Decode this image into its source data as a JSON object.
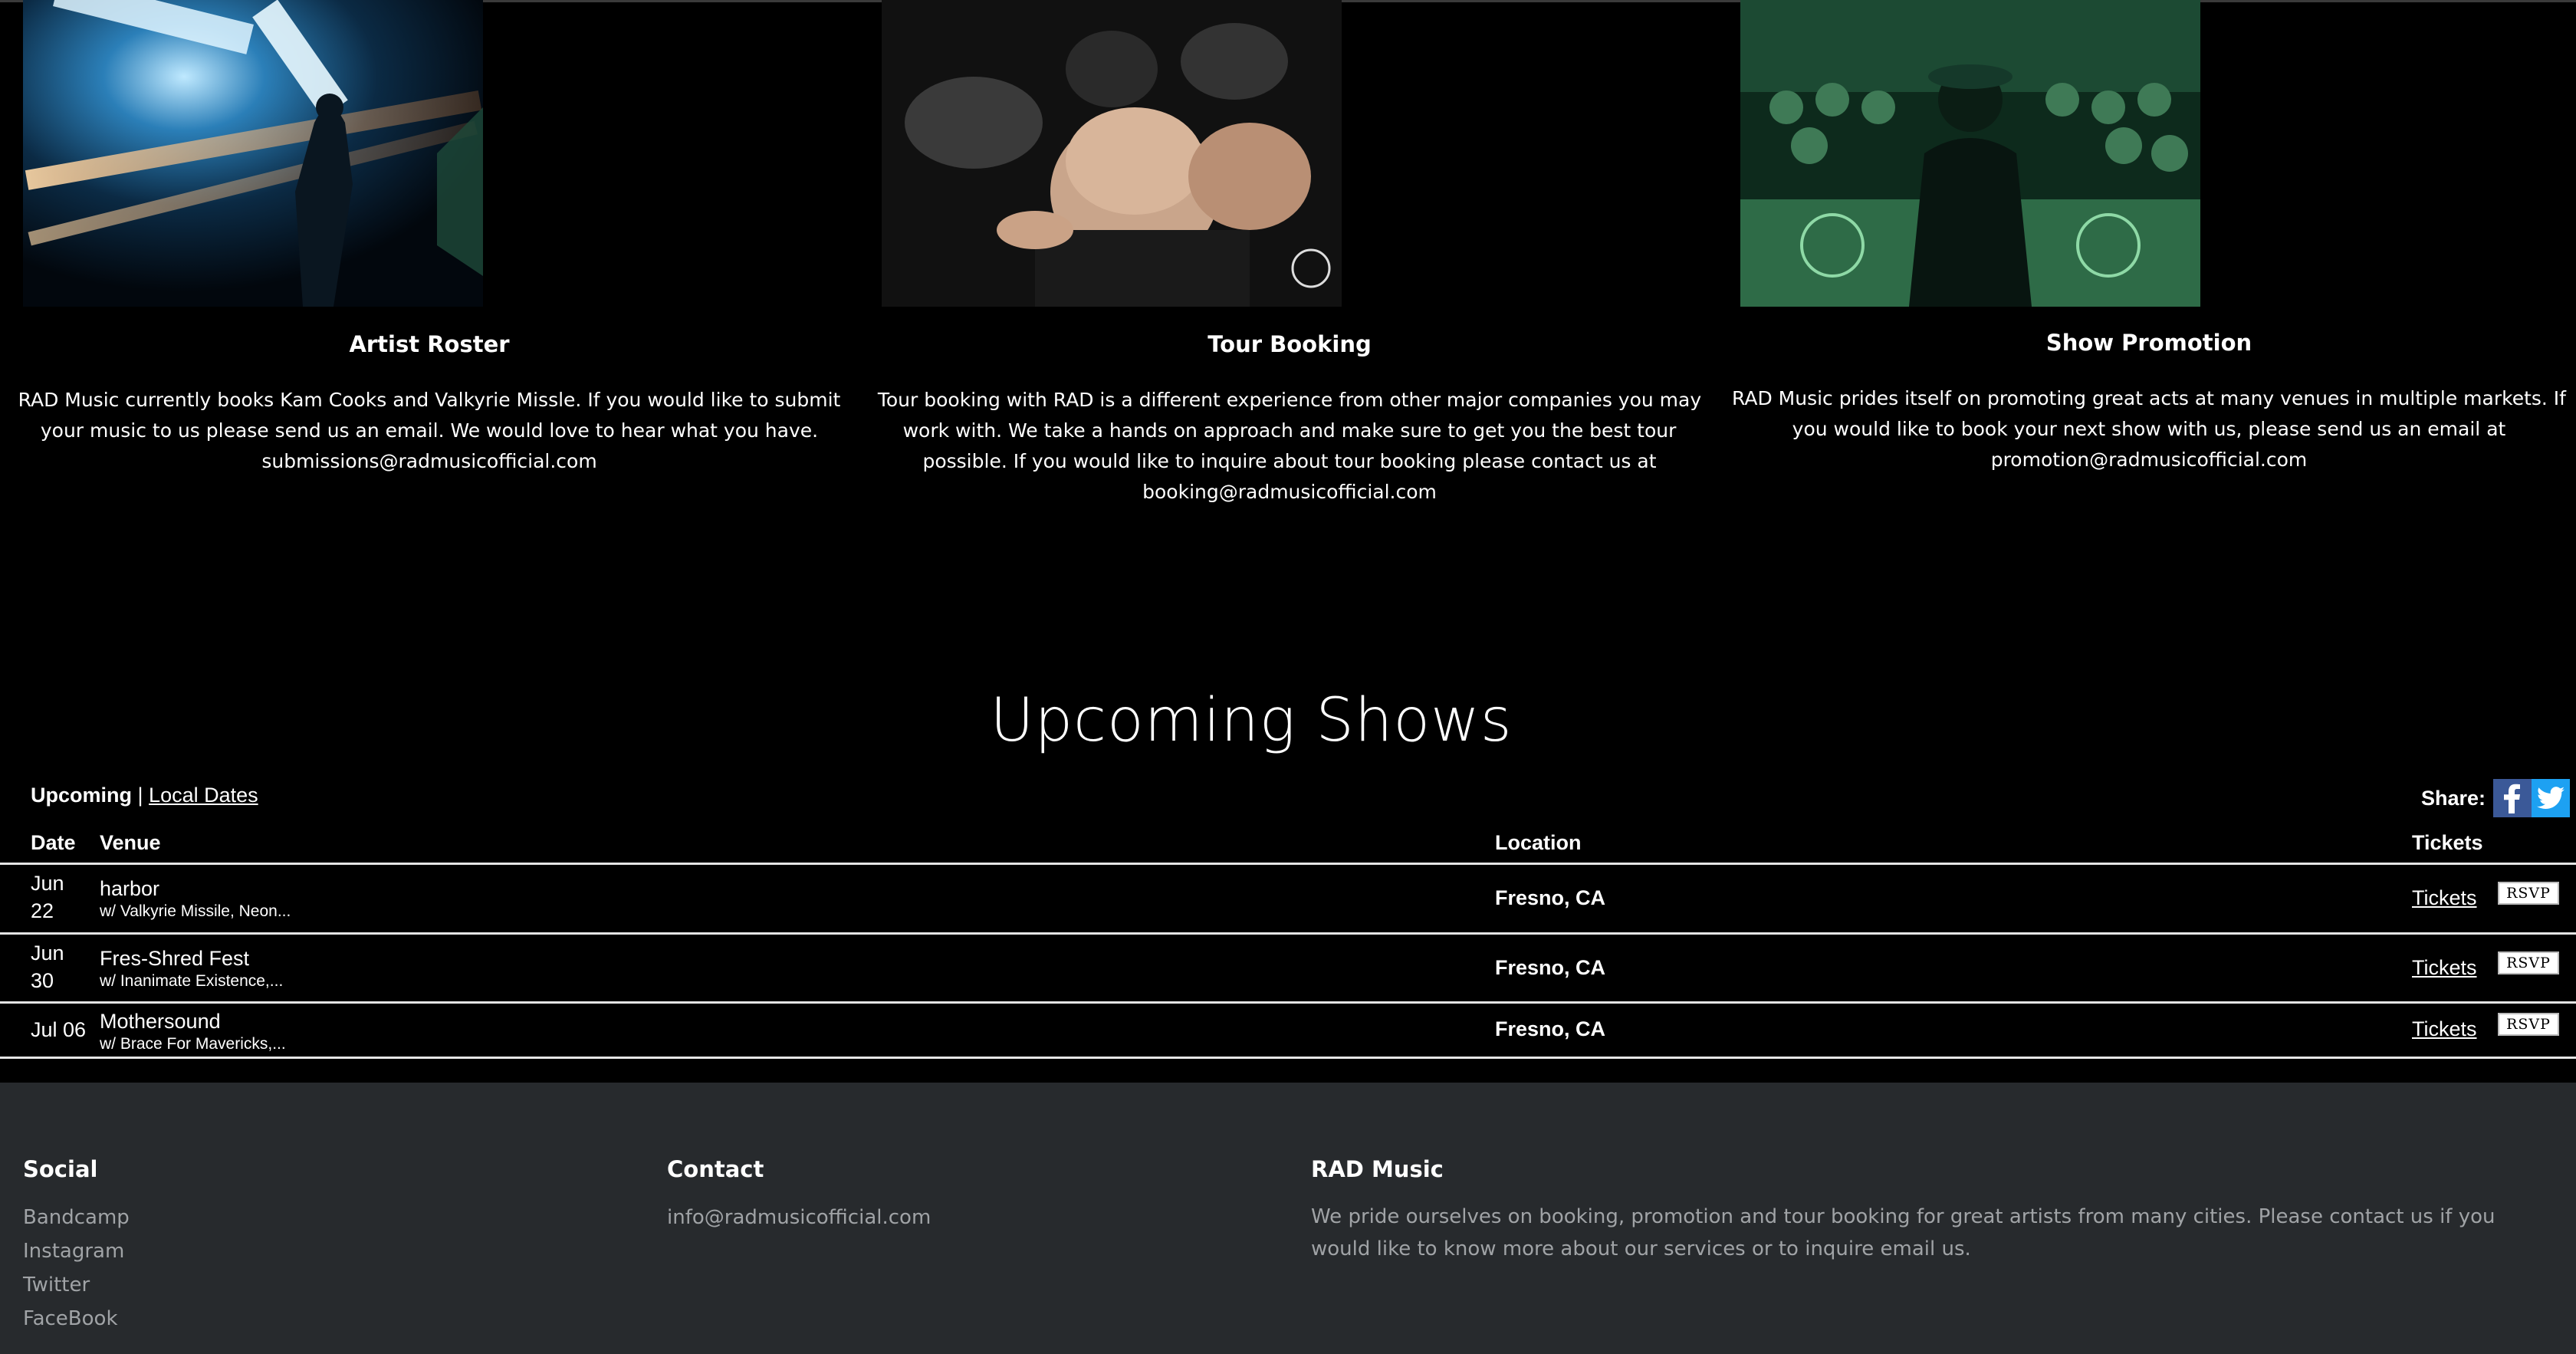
{
  "services": [
    {
      "title": "Artist Roster",
      "body": "RAD Music currently books Kam Cooks and Valkyrie Missle. If you would like to submit your music to us please send us an email. We would love to hear what you have. submissions@radmusicofficial.com",
      "image": "concert-stage-lights-photo"
    },
    {
      "title": "Tour Booking",
      "body": "Tour booking with RAD is a different experience from other major companies you may work with. We take a hands on approach and make sure to get you the best tour possible. If you would like to inquire about tour booking please contact us at booking@radmusicofficial.com",
      "image": "crowd-mosh-pit-photo"
    },
    {
      "title": "Show Promotion",
      "body": "RAD Music prides itself on promoting great acts at many venues in multiple markets. If you would like to book your next show with us, please send us an email at promotion@radmusicofficial.com",
      "image": "dj-crowd-green-photo"
    }
  ],
  "shows": {
    "title": "Upcoming Shows",
    "filter_active": "Upcoming",
    "filter_separator": "|",
    "filter_link": "Local Dates",
    "share_label": "Share:",
    "columns": {
      "date": "Date",
      "venue": "Venue",
      "location": "Location",
      "tickets": "Tickets"
    },
    "rows": [
      {
        "date_month": "Jun",
        "date_day": "22",
        "venue": "harbor",
        "support": "w/ Valkyrie Missile, Neon...",
        "location": "Fresno, CA",
        "tickets": "Tickets",
        "rsvp": "RSVP"
      },
      {
        "date_month": "Jun",
        "date_day": "30",
        "venue": "Fres-Shred Fest",
        "support": "w/ Inanimate Existence,...",
        "location": "Fresno, CA",
        "tickets": "Tickets",
        "rsvp": "RSVP"
      },
      {
        "date_month": "Jul 06",
        "date_day": "",
        "venue": "Mothersound",
        "support": "w/ Brace For Mavericks,...",
        "location": "Fresno, CA",
        "tickets": "Tickets",
        "rsvp": "RSVP"
      }
    ]
  },
  "footer": {
    "social": {
      "heading": "Social",
      "links": [
        "Bandcamp",
        "Instagram",
        "Twitter",
        "FaceBook"
      ]
    },
    "contact": {
      "heading": "Contact",
      "email": "info@radmusicofficial.com"
    },
    "about": {
      "heading": "RAD Music",
      "text": "We pride ourselves on booking, promotion and tour booking for great artists from many cities. Please contact us if you would like to know more about our services or to inquire email us."
    }
  },
  "colors": {
    "background": "#000000",
    "footer_bg": "#272a2d",
    "footer_text": "#a0a3a6",
    "facebook": "#3b5998",
    "twitter": "#1da1f2"
  }
}
